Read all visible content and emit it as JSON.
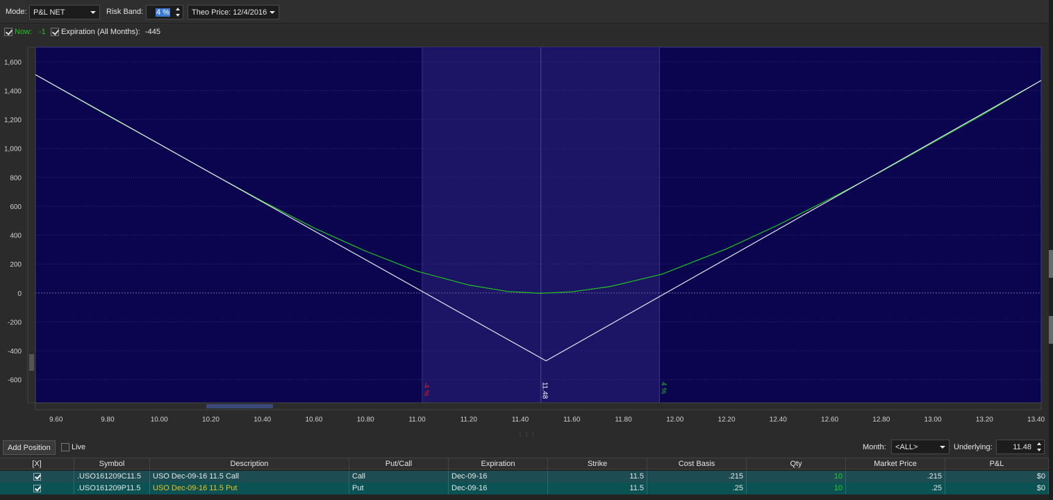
{
  "toolbar": {
    "mode_label": "Mode:",
    "mode_value": "P&L NET",
    "risk_band_label": "Risk Band:",
    "risk_band_value": "4 %",
    "theo_price_value": "Theo Price: 12/4/2016"
  },
  "legend": {
    "now_label": "Now:",
    "now_value": "-1",
    "expiration_label": "Expiration (All Months):",
    "expiration_value": "-445"
  },
  "colors": {
    "plot_bg": "#0b0550",
    "band_bg": "#1c1464",
    "now_line": "#22c522",
    "expiration_line": "#e8e8f0",
    "minus_band": "#e02020",
    "plus_band": "#22c522"
  },
  "chart_data": {
    "type": "line",
    "title": "",
    "xlabel": "",
    "ylabel": "",
    "xlim": [
      9.52,
      13.42
    ],
    "ylim": [
      -760,
      1700
    ],
    "x_ticks": [
      "9.60",
      "9.80",
      "10.00",
      "10.20",
      "10.40",
      "10.60",
      "10.80",
      "11.00",
      "11.20",
      "11.40",
      "11.60",
      "11.80",
      "12.00",
      "12.20",
      "12.40",
      "12.60",
      "12.80",
      "13.00",
      "13.20",
      "13.40"
    ],
    "x_tick_values": [
      9.6,
      9.8,
      10.0,
      10.2,
      10.4,
      10.6,
      10.8,
      11.0,
      11.2,
      11.4,
      11.6,
      11.8,
      12.0,
      12.2,
      12.4,
      12.6,
      12.8,
      13.0,
      13.2,
      13.4
    ],
    "y_ticks": [
      "1,600",
      "1,400",
      "1,200",
      "1,000",
      "800",
      "600",
      "400",
      "200",
      "0",
      "-200",
      "-400",
      "-600"
    ],
    "y_tick_values": [
      1600,
      1400,
      1200,
      1000,
      800,
      600,
      400,
      200,
      0,
      -200,
      -400,
      -600
    ],
    "grid": true,
    "series": [
      {
        "name": "Now",
        "x": [
          9.52,
          9.8,
          10.0,
          10.2,
          10.4,
          10.6,
          10.8,
          11.0,
          11.2,
          11.35,
          11.48,
          11.6,
          11.75,
          11.95,
          12.2,
          12.4,
          12.6,
          12.8,
          13.0,
          13.2,
          13.42
        ],
        "y": [
          1510,
          1227,
          1030,
          830,
          635,
          450,
          290,
          150,
          55,
          10,
          -3,
          8,
          45,
          130,
          305,
          470,
          650,
          840,
          1040,
          1240,
          1470
        ]
      },
      {
        "name": "Expiration (All Months)",
        "x": [
          9.52,
          11.5,
          13.42
        ],
        "y": [
          1510,
          -470,
          1470
        ]
      }
    ],
    "risk_band": {
      "low": 11.02,
      "center": 11.48,
      "high": 11.94
    },
    "band_labels": {
      "low": "-4 %",
      "center": "11.48",
      "high": "4 %"
    }
  },
  "positions_bar": {
    "add_position_label": "Add Position",
    "live_label": "Live",
    "month_label": "Month:",
    "month_value": "<ALL>",
    "underlying_label": "Underlying:",
    "underlying_value": "11.48"
  },
  "table": {
    "columns": [
      "[X]",
      "Symbol",
      "Description",
      "Put/Call",
      "Expiration",
      "Strike",
      "Cost Basis",
      "Qty",
      "Market Price",
      "P&L"
    ],
    "rows": [
      {
        "symbol": ".USO161209C11.5",
        "description": "USO Dec-09-16 11.5 Call",
        "putcall": "Call",
        "expiration": "Dec-09-16",
        "strike": "11.5",
        "cost_basis": ".215",
        "qty": "10",
        "market_price": ".215",
        "pnl": "$0"
      },
      {
        "symbol": ".USO161209P11.5",
        "description": "USO Dec-09-16 11.5 Put",
        "putcall": "Put",
        "expiration": "Dec-09-16",
        "strike": "11.5",
        "cost_basis": ".25",
        "qty": "10",
        "market_price": ".25",
        "pnl": "$0"
      }
    ]
  }
}
